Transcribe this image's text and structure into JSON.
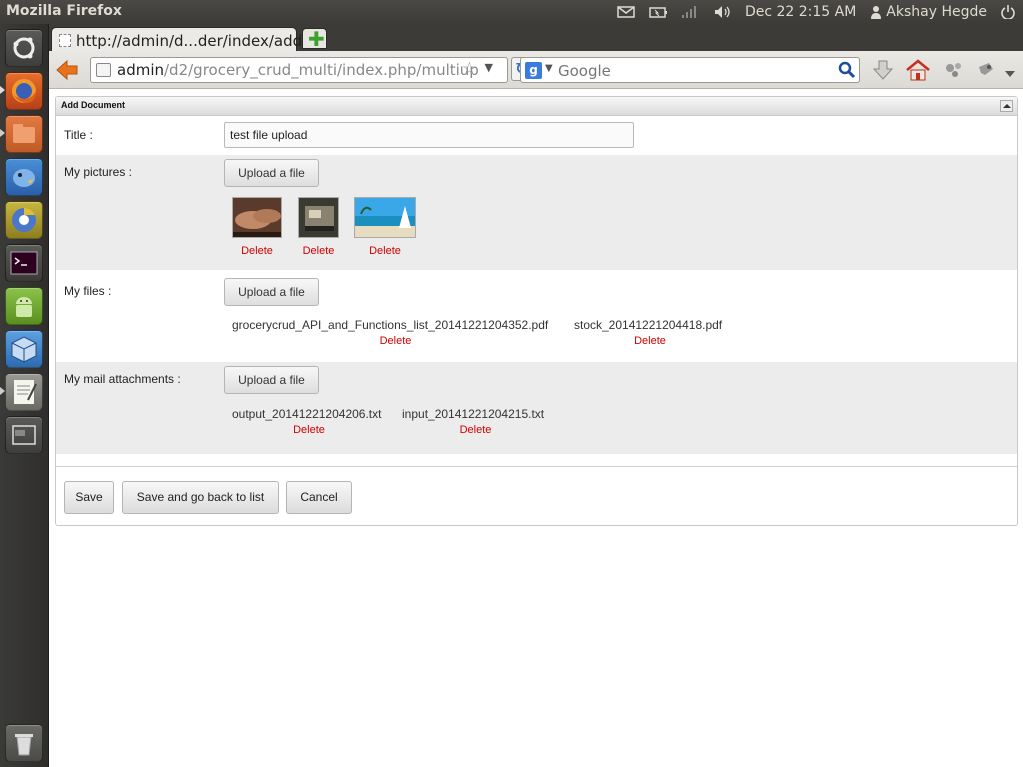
{
  "system": {
    "app_title": "Mozilla Firefox",
    "clock": "Dec 22  2:15 AM",
    "user": "Akshay Hegde"
  },
  "launcher": {
    "items": [
      "dash-home",
      "firefox",
      "files",
      "pidgin",
      "chromium",
      "terminal",
      "android-sdk",
      "virtualbox",
      "text-editor",
      "workspace-switcher",
      "trash"
    ]
  },
  "browser": {
    "tab_title": "http://admin/d...der/index/add",
    "url_host": "admin",
    "url_path": "/d2/grocery_crud_multi/index.php/multiup",
    "search_placeholder": "Google"
  },
  "form": {
    "heading": "Add Document",
    "title_label": "Title :",
    "title_value": "test file upload",
    "pictures_label": "My pictures :",
    "files_label": "My files :",
    "mail_label": "My mail attachments :",
    "upload_label": "Upload a file",
    "delete_label": "Delete",
    "files": [
      "grocerycrud_API_and_Functions_list_20141221204352.pdf",
      "stock_20141221204418.pdf"
    ],
    "attachments": [
      "output_20141221204206.txt",
      "input_20141221204215.txt"
    ]
  },
  "actions": {
    "save": "Save",
    "save_back": "Save and go back to list",
    "cancel": "Cancel"
  }
}
